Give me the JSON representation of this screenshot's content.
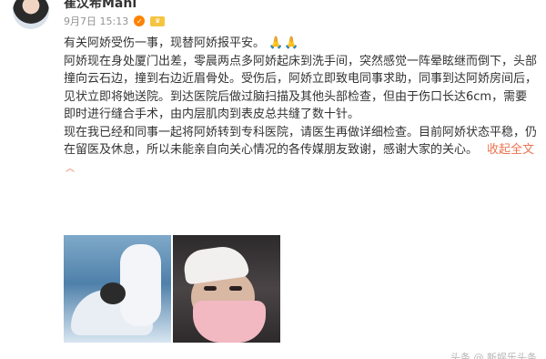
{
  "post": {
    "author": "崔汶希Mani",
    "time": "9月7日 15:13",
    "paragraphs": [
      "有关阿娇受伤一事，现替阿娇报平安。",
      "阿娇现在身处厦门出差，零晨两点多阿娇起床到洗手间，突然感觉一阵晕眩继而倒下，头部撞向云石边，撞到右边近眉骨处。受伤后，阿娇立即致电同事求助，同事到达阿娇房间后，见状立即将她送院。到达医院后做过脑扫描及其他头部检查，但由于伤口长达6cm，需要即时进行缝合手术，由内层肌肉到表皮总共缝了数十针。",
      "现在我已经和同事一起将阿娇转到专科医院，请医生再做详细检查。目前阿娇状态平稳，仍在留医及休息，所以未能亲自向关心情况的各传媒朋友致谢，感谢大家的关心。"
    ],
    "emoji": "🙏🙏",
    "collapse_label": "收起全文",
    "collapse_icon": "︿"
  },
  "footer": {
    "text": "头条 @ 新娱乐头条"
  }
}
